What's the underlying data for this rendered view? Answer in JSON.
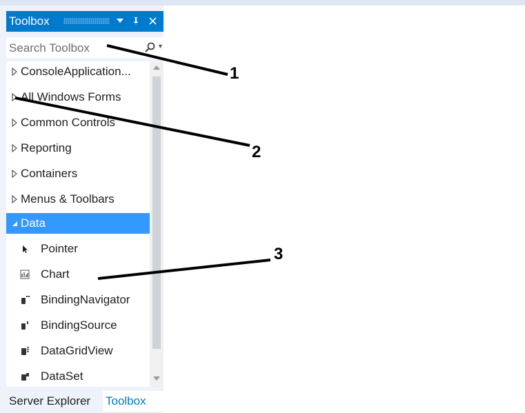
{
  "toolbox": {
    "title": "Toolbox",
    "dropdown_icon": "triangle-down-icon",
    "pin_icon": "pin-icon",
    "close_icon": "close-icon",
    "search_placeholder": "Search Toolbox",
    "groups": [
      {
        "label": "ConsoleApplication...",
        "expanded": false
      },
      {
        "label": "All Windows Forms",
        "expanded": false
      },
      {
        "label": "Common Controls",
        "expanded": false
      },
      {
        "label": "Reporting",
        "expanded": false
      },
      {
        "label": "Containers",
        "expanded": false
      },
      {
        "label": "Menus & Toolbars",
        "expanded": false
      },
      {
        "label": "Data",
        "expanded": true,
        "selected": true
      }
    ],
    "data_items": [
      {
        "label": "Pointer",
        "icon": "pointer-arrow-icon"
      },
      {
        "label": "Chart",
        "icon": "chart-icon"
      },
      {
        "label": "BindingNavigator",
        "icon": "binding-navigator-icon"
      },
      {
        "label": "BindingSource",
        "icon": "binding-source-icon"
      },
      {
        "label": "DataGridView",
        "icon": "datagridview-icon"
      },
      {
        "label": "DataSet",
        "icon": "dataset-icon"
      }
    ]
  },
  "bottom_tabs": [
    {
      "label": "Server Explorer",
      "active": false
    },
    {
      "label": "Toolbox",
      "active": true
    }
  ],
  "annotations": [
    "1",
    "2",
    "3"
  ],
  "colors": {
    "accent": "#007acc",
    "selection": "#3399ff",
    "panel_bg": "#eef2fa"
  }
}
